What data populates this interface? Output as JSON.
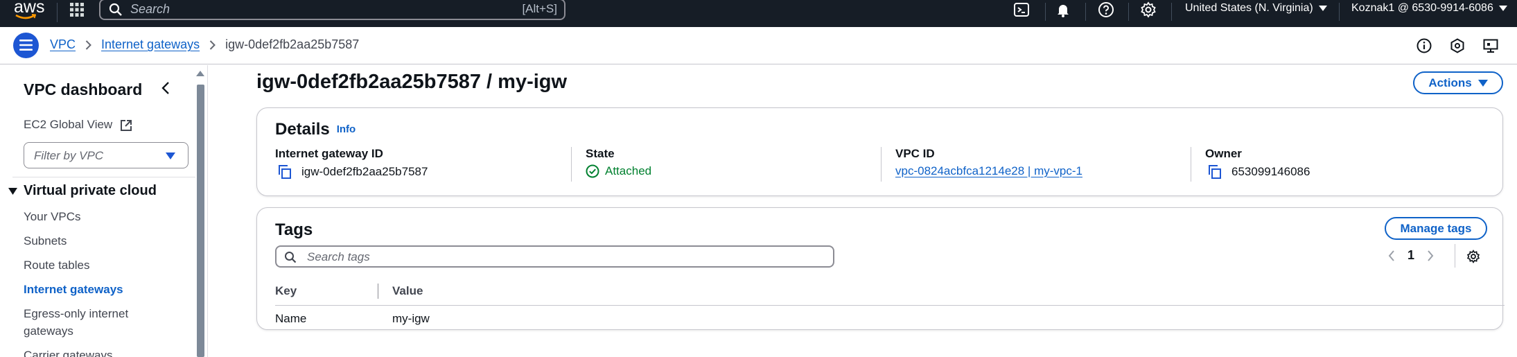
{
  "topnav": {
    "logo_text": "aws",
    "search_placeholder": "Search",
    "search_shortcut": "[Alt+S]",
    "region": "United States (N. Virginia)",
    "account": "Koznak1 @ 6530-9914-6086",
    "icons": [
      "apps-icon",
      "cloudshell-icon",
      "notifications-icon",
      "help-icon",
      "settings-icon"
    ]
  },
  "breadcrumb": {
    "items": [
      "VPC",
      "Internet gateways"
    ],
    "current": "igw-0def2fb2aa25b7587"
  },
  "sidebar": {
    "title": "VPC dashboard",
    "global_view": "EC2 Global View",
    "filter_placeholder": "Filter by VPC",
    "section": "Virtual private cloud",
    "items": [
      {
        "label": "Your VPCs",
        "active": false
      },
      {
        "label": "Subnets",
        "active": false
      },
      {
        "label": "Route tables",
        "active": false
      },
      {
        "label": "Internet gateways",
        "active": true
      },
      {
        "label": "Egress-only internet gateways",
        "active": false
      },
      {
        "label": "Carrier gateways",
        "active": false
      }
    ]
  },
  "main": {
    "title": "igw-0def2fb2aa25b7587 / my-igw",
    "actions_label": "Actions",
    "details": {
      "heading": "Details",
      "info": "Info",
      "columns": [
        {
          "label": "Internet gateway ID",
          "value": "igw-0def2fb2aa25b7587"
        },
        {
          "label": "State",
          "value": "Attached"
        },
        {
          "label": "VPC ID",
          "value": "vpc-0824acbfca1214e28 | my-vpc-1"
        },
        {
          "label": "Owner",
          "value": "653099146086"
        }
      ]
    },
    "tags": {
      "heading": "Tags",
      "manage_label": "Manage tags",
      "search_placeholder": "Search tags",
      "page": "1",
      "columns": [
        "Key",
        "Value"
      ],
      "rows": [
        {
          "key": "Name",
          "value": "my-igw"
        }
      ]
    }
  },
  "colors": {
    "nav_bg": "#161d26",
    "link": "#0f62c8",
    "success": "#00802f",
    "menu_button": "#1d56d3"
  }
}
